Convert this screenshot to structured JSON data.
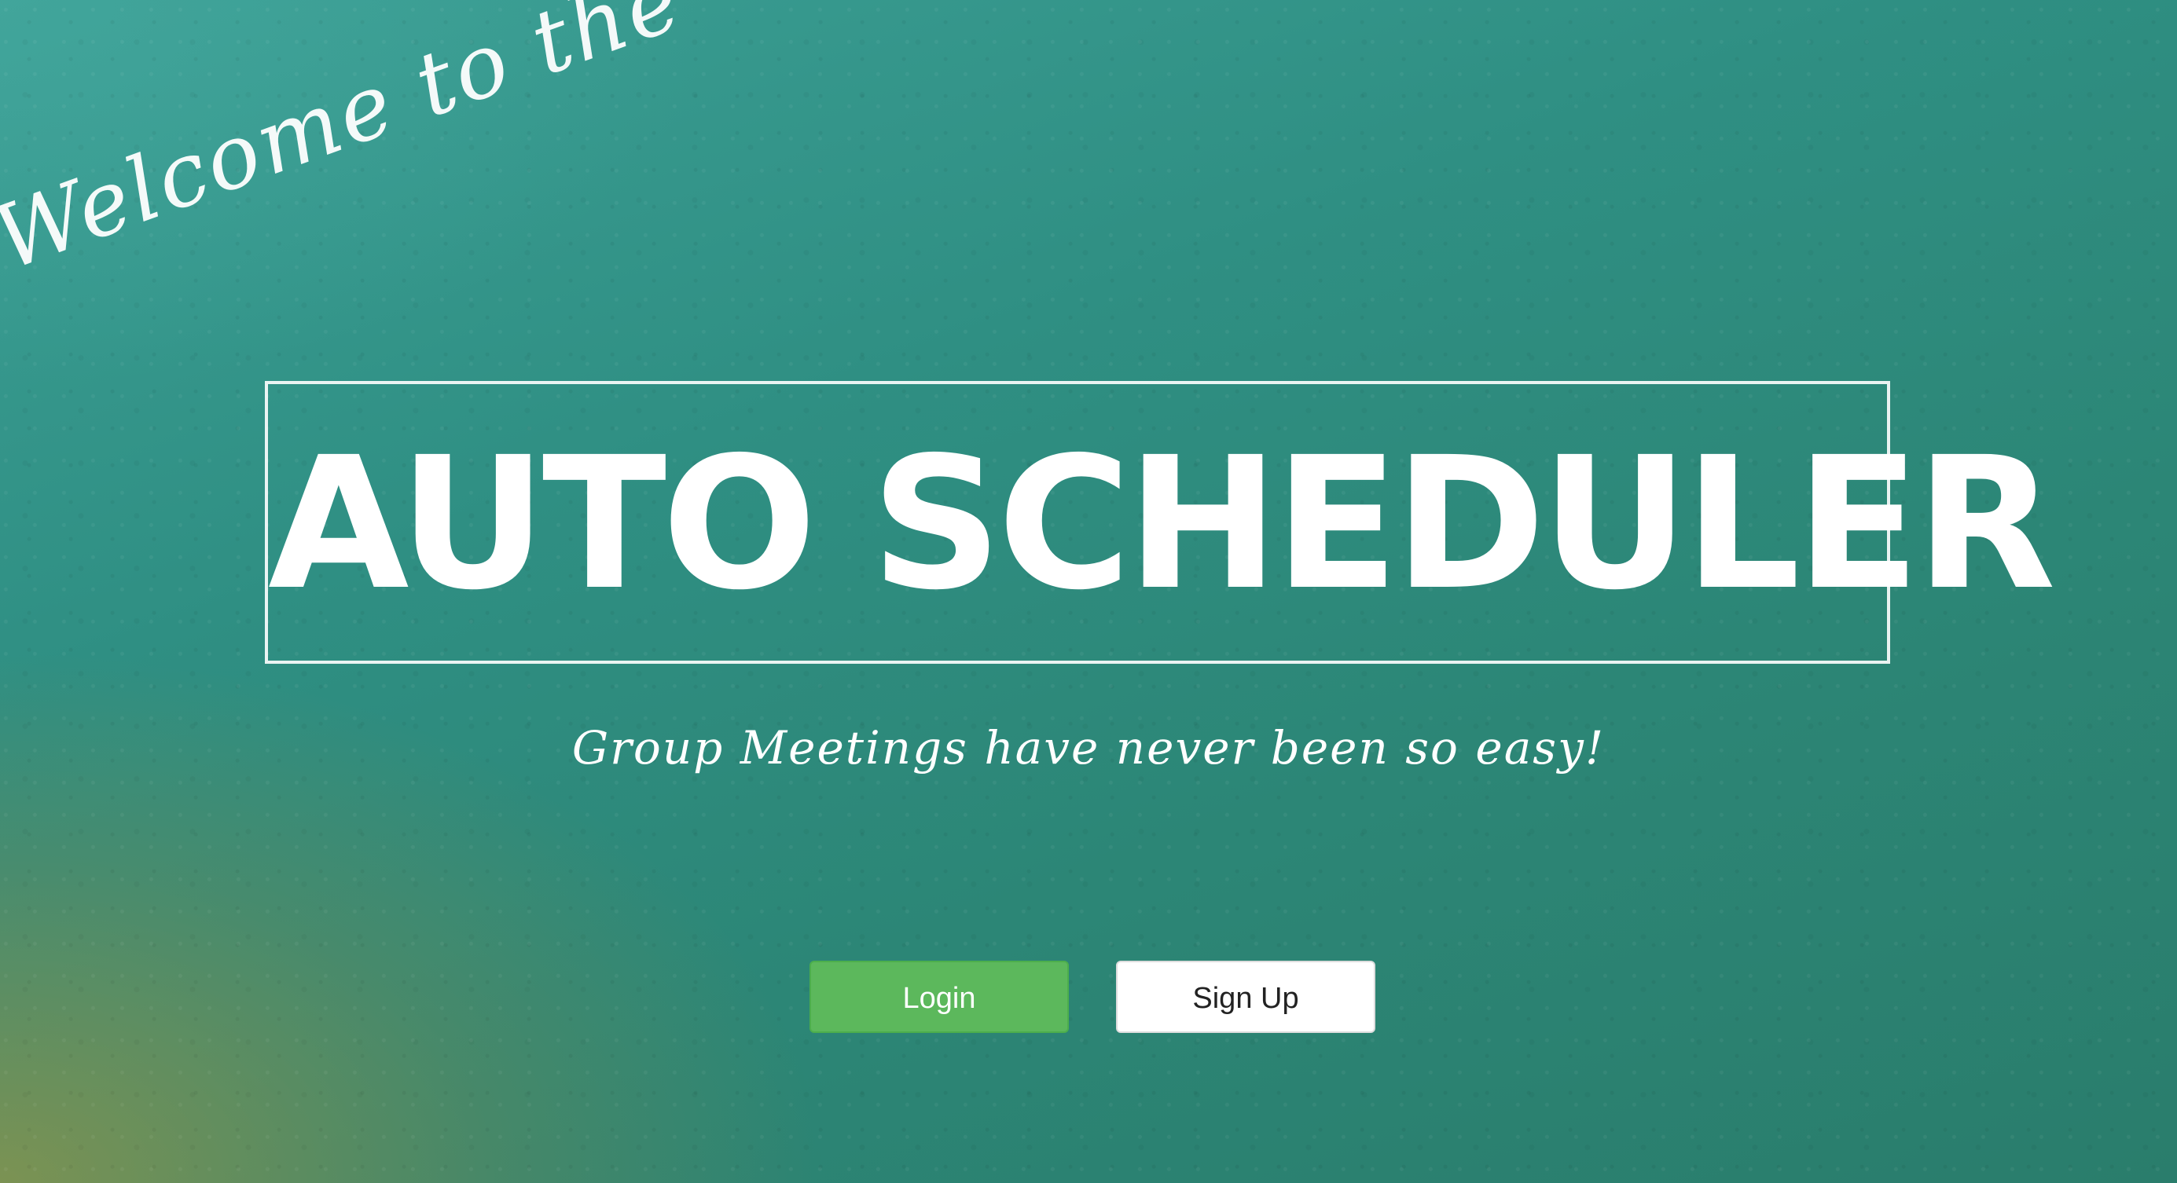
{
  "hero": {
    "welcome_text": "Welcome to the",
    "title": "AUTO SCHEDULER",
    "tagline": "Group Meetings have never been so easy!"
  },
  "actions": {
    "login_label": "Login",
    "signup_label": "Sign Up"
  },
  "colors": {
    "background_primary": "#2f8f83",
    "background_accent": "#969646",
    "login_button": "#5cb85c",
    "signup_button": "#ffffff",
    "text": "#ffffff"
  }
}
